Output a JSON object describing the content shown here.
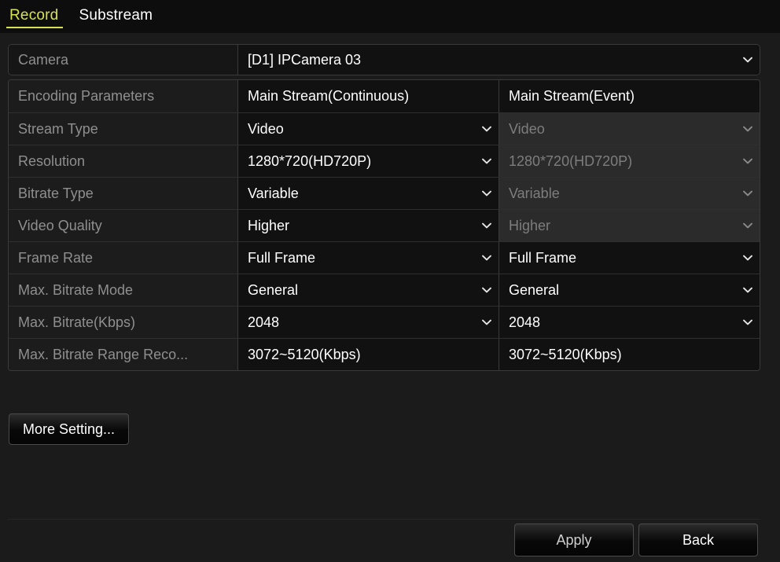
{
  "tabs": [
    {
      "label": "Record",
      "active": true
    },
    {
      "label": "Substream",
      "active": false
    }
  ],
  "colors": {
    "accent": "#d6e24f",
    "page_background": "#1b1b1b",
    "tabbar_background": "#0d0d0d",
    "label_text": "#8f8f8f",
    "value_text": "#ffffff",
    "disabled_text": "#7d7d7d",
    "disabled_background": "#2b2b2b",
    "border": "#3a3a3a"
  },
  "camera": {
    "label": "Camera",
    "value": "[D1] IPCamera 03",
    "icon": "chevron-down-icon"
  },
  "table": {
    "columns": [
      {
        "key": "label",
        "header": "Encoding Parameters"
      },
      {
        "key": "continuous",
        "header": "Main Stream(Continuous)"
      },
      {
        "key": "event",
        "header": "Main Stream(Event)"
      }
    ],
    "rows": [
      {
        "label": "Stream Type",
        "continuous": "Video",
        "event": "Video",
        "continuous_disabled": false,
        "event_disabled": true,
        "has_dropdown": true
      },
      {
        "label": "Resolution",
        "continuous": "1280*720(HD720P)",
        "event": "1280*720(HD720P)",
        "continuous_disabled": false,
        "event_disabled": true,
        "has_dropdown": true
      },
      {
        "label": "Bitrate Type",
        "continuous": "Variable",
        "event": "Variable",
        "continuous_disabled": false,
        "event_disabled": true,
        "has_dropdown": true
      },
      {
        "label": "Video Quality",
        "continuous": "Higher",
        "event": "Higher",
        "continuous_disabled": false,
        "event_disabled": true,
        "has_dropdown": true
      },
      {
        "label": "Frame Rate",
        "continuous": "Full Frame",
        "event": "Full Frame",
        "continuous_disabled": false,
        "event_disabled": false,
        "has_dropdown": true
      },
      {
        "label": "Max. Bitrate Mode",
        "continuous": "General",
        "event": "General",
        "continuous_disabled": false,
        "event_disabled": false,
        "has_dropdown": true
      },
      {
        "label": "Max. Bitrate(Kbps)",
        "continuous": "2048",
        "event": "2048",
        "continuous_disabled": false,
        "event_disabled": false,
        "has_dropdown": true
      },
      {
        "label": "Max. Bitrate Range Reco...",
        "continuous": "3072~5120(Kbps)",
        "event": "3072~5120(Kbps)",
        "continuous_disabled": false,
        "event_disabled": false,
        "has_dropdown": false
      }
    ]
  },
  "buttons": {
    "more_setting": "More Setting...",
    "apply": "Apply",
    "back": "Back"
  }
}
